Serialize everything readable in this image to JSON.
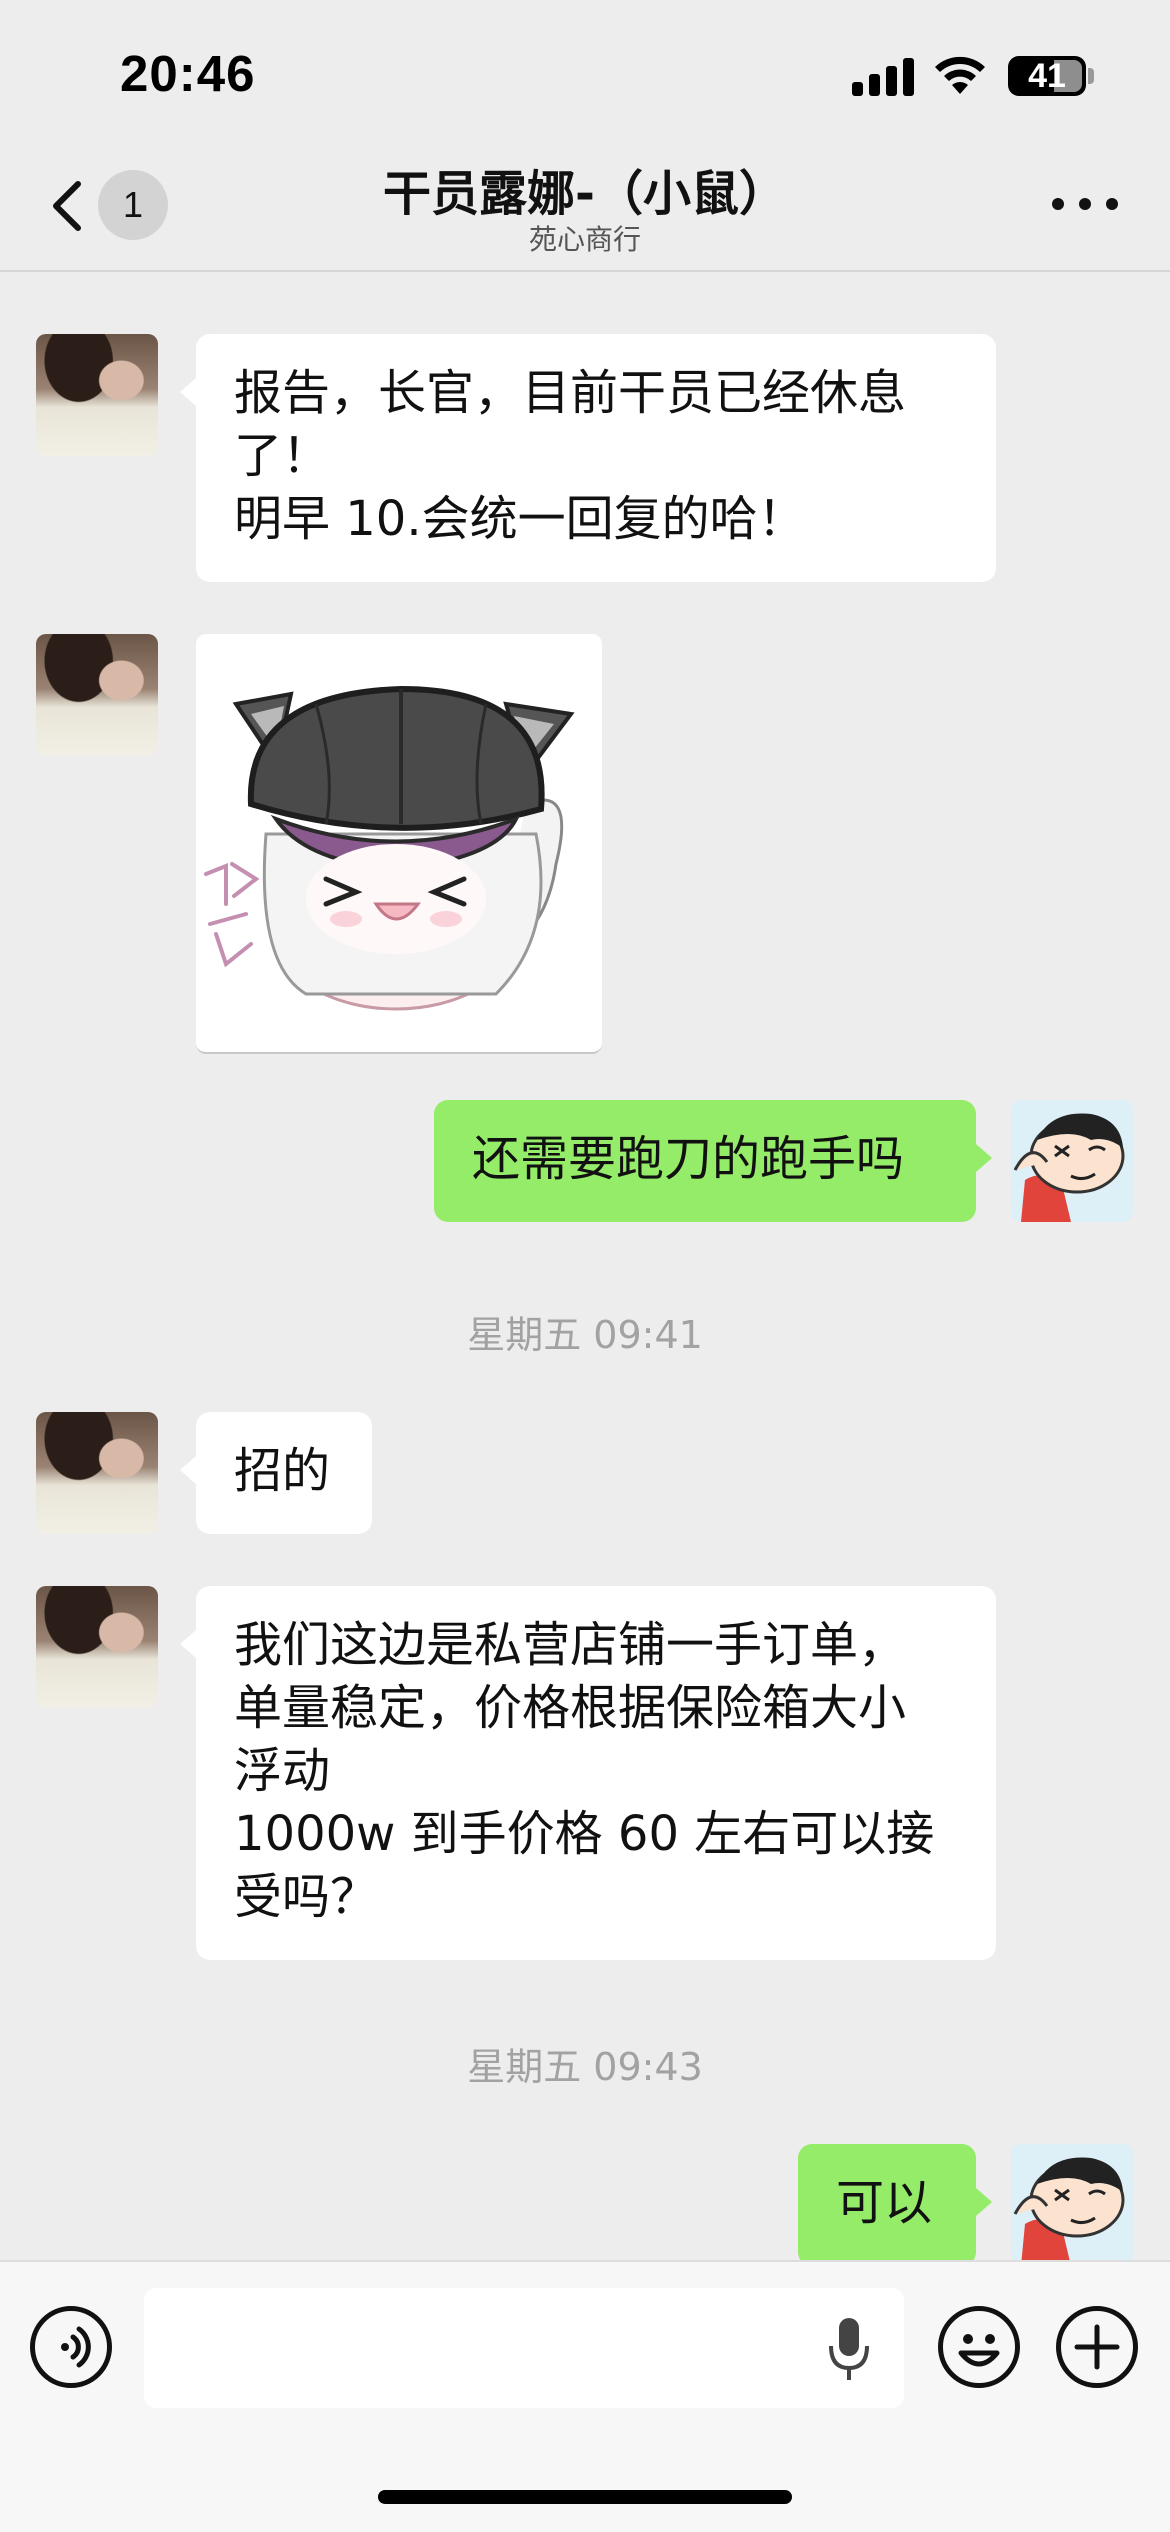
{
  "status_bar": {
    "time": "20:46",
    "battery_level": "41",
    "icons": [
      "cellular-signal-icon",
      "wifi-icon",
      "battery-icon"
    ]
  },
  "nav": {
    "back_icon": "chevron-left-icon",
    "unread_count": "1",
    "title": "干员露娜-（小鼠）",
    "subtitle": "苑心商行",
    "more_icon": "more-dots-icon"
  },
  "messages": [
    {
      "side": "left",
      "type": "text",
      "text": "报告，长官，目前干员已经休息\n了！\n明早 10.会统一回复的哈！"
    },
    {
      "side": "left",
      "type": "sticker",
      "text": "哈气",
      "sticker_name": "cat-hat-girl-sticker"
    },
    {
      "side": "right",
      "type": "text",
      "text": "还需要跑刀的跑手吗"
    },
    {
      "type": "timestamp",
      "text": "星期五 09:41"
    },
    {
      "side": "left",
      "type": "text",
      "text": "招的"
    },
    {
      "side": "left",
      "type": "text",
      "text": "我们这边是私营店铺一手订单，\n单量稳定，价格根据保险箱大小\n浮动\n1000w 到手价格 60 左右可以接\n受吗？"
    },
    {
      "type": "timestamp",
      "text": "星期五 09:43"
    },
    {
      "side": "right",
      "type": "text",
      "text": "可以"
    }
  ],
  "input_bar": {
    "placeholder": "",
    "icons": [
      "voice-mode-icon",
      "microphone-icon",
      "emoji-icon",
      "plus-icon"
    ]
  },
  "colors": {
    "background": "#EDEDED",
    "outgoing_bubble": "#95EC69",
    "incoming_bubble": "#FFFFFF",
    "timestamp": "#A2A2A2"
  }
}
